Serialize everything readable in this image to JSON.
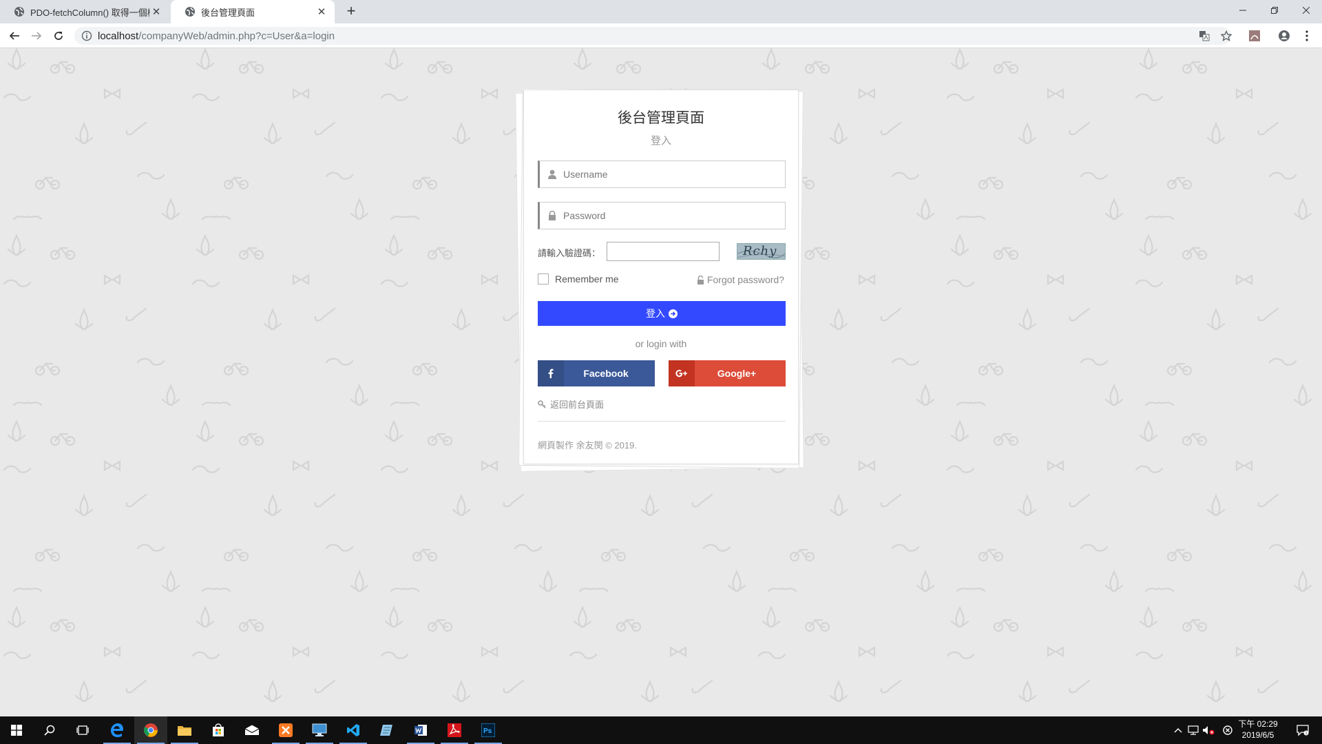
{
  "browser": {
    "tabs": [
      {
        "title": "PDO-fetchColumn() 取得一個欄位",
        "active": false
      },
      {
        "title": "後台管理頁面",
        "active": true
      }
    ],
    "url_host": "localhost",
    "url_path": "/companyWeb/admin.php?c=User&a=login"
  },
  "login": {
    "title": "後台管理頁面",
    "subtitle": "登入",
    "username_placeholder": "Username",
    "password_placeholder": "Password",
    "captcha_label": "請輸入驗證碼：",
    "captcha_text": "Rchy",
    "remember_label": "Remember me",
    "remember_checked": false,
    "forgot_label": "Forgot password?",
    "submit_label": "登入",
    "or_text": "or login with",
    "facebook_label": "Facebook",
    "google_label": "Google+",
    "back_label": "返回前台頁面",
    "footer": "網頁製作 余友閔 © 2019.",
    "colors": {
      "submit": "#3349ff",
      "facebook": "#3b5998",
      "google": "#dd4b39"
    }
  },
  "taskbar": {
    "apps": [
      "windows-start-icon",
      "search-icon",
      "task-view-icon",
      "edge-icon",
      "chrome-icon",
      "file-explorer-icon",
      "store-icon",
      "mail-icon",
      "xampp-icon",
      "remote-desktop-icon",
      "vscode-icon",
      "notepad-icon",
      "word-icon",
      "acrobat-icon",
      "photoshop-icon"
    ],
    "time": "下午 02:29",
    "date": "2019/6/5"
  }
}
